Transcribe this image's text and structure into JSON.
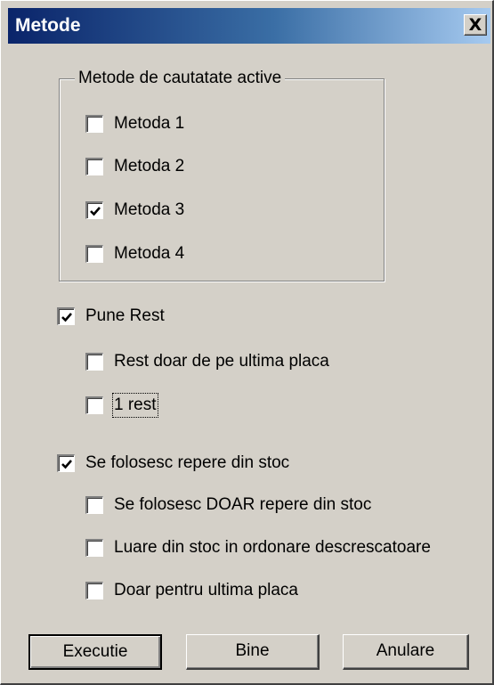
{
  "window": {
    "title": "Metode",
    "close_label": "X"
  },
  "group": {
    "label": "Metode de cautatate active",
    "items": [
      {
        "label": "Metoda 1",
        "checked": false
      },
      {
        "label": "Metoda 2",
        "checked": false
      },
      {
        "label": "Metoda 3",
        "checked": true
      },
      {
        "label": "Metoda 4",
        "checked": false
      }
    ]
  },
  "options": {
    "pune_rest": {
      "label": "Pune Rest",
      "checked": true
    },
    "rest_doar": {
      "label": "Rest doar de pe ultima placa",
      "checked": false
    },
    "one_rest": {
      "label": "1 rest",
      "checked": false
    },
    "repere_stoc": {
      "label": "Se folosesc repere din stoc",
      "checked": true
    },
    "doar_stoc": {
      "label": "Se folosesc DOAR repere din stoc",
      "checked": false
    },
    "luare_stoc": {
      "label": "Luare din stoc in ordonare descrescatoare",
      "checked": false
    },
    "doar_ultima": {
      "label": "Doar pentru ultima placa",
      "checked": false
    }
  },
  "buttons": {
    "execute": "Executie",
    "ok": "Bine",
    "cancel": "Anulare"
  }
}
